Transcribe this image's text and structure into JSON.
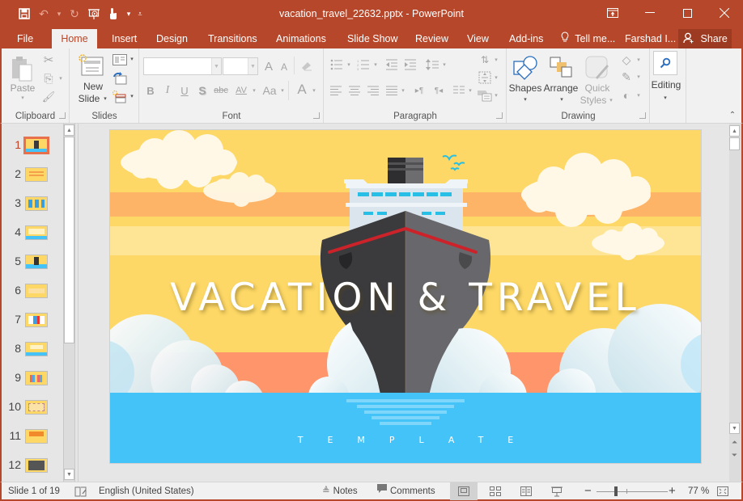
{
  "window": {
    "title": "vacation_travel_22632.pptx - PowerPoint",
    "controls": {
      "ribbon_display": "▣",
      "minimize": "—",
      "maximize": "☐",
      "close": "✕"
    }
  },
  "quick_access": {
    "save_icon": "💾",
    "undo_icon": "↶",
    "undo_dropdown": "▾",
    "redo_icon": "↻",
    "present_icon": "⎚",
    "touch_mode_icon": "☝",
    "touch_dropdown": "▾",
    "customize_icon": "⩡"
  },
  "tabs": [
    {
      "label": "File",
      "active": false
    },
    {
      "label": "Home",
      "active": true
    },
    {
      "label": "Insert",
      "active": false
    },
    {
      "label": "Design",
      "active": false
    },
    {
      "label": "Transitions",
      "active": false
    },
    {
      "label": "Animations",
      "active": false
    },
    {
      "label": "Slide Show",
      "active": false
    },
    {
      "label": "Review",
      "active": false
    },
    {
      "label": "View",
      "active": false
    },
    {
      "label": "Add-ins",
      "active": false
    }
  ],
  "tell_me": {
    "icon": "💡",
    "label": "Tell me..."
  },
  "user": {
    "name": "Farshad I..."
  },
  "share": {
    "icon": "👤",
    "label": "Share"
  },
  "ribbon": {
    "clipboard": {
      "label": "Clipboard",
      "paste": "Paste",
      "paste_dropdown": "▾",
      "cut_icon": "✂",
      "copy_icon": "⎘",
      "copy_dropdown": "▾",
      "format_painter_icon": "🖌"
    },
    "slides": {
      "label": "Slides",
      "new_slide_line1": "New",
      "new_slide_line2": "Slide",
      "new_slide_dropdown": "▾",
      "layout_icon": "▤",
      "reset_icon": "⟲",
      "section_icon": "▭"
    },
    "font": {
      "label": "Font",
      "font_name_value": "",
      "font_size_value": "",
      "grow_font": "A",
      "shrink_font": "A",
      "clear_formatting_icon": "⌫",
      "bold": "B",
      "italic": "I",
      "underline": "U",
      "shadow": "S",
      "strikethrough": "abc",
      "char_spacing": "AV",
      "change_case": "Aa",
      "font_color": "A"
    },
    "paragraph": {
      "label": "Paragraph",
      "bullets_icon": "☰",
      "numbering_icon": "☷",
      "decrease_indent_icon": "⇤",
      "increase_indent_icon": "⇥",
      "line_spacing_icon": "↕",
      "text_direction_icon": "⇅",
      "align_text_icon": "⇳",
      "smartart_icon": "⊞",
      "align_left_icon": "≡",
      "center_icon": "≡",
      "align_right_icon": "≡",
      "justify_icon": "≡",
      "ltr_icon": "▸¶",
      "rtl_icon": "¶◂",
      "columns_icon": "☷"
    },
    "drawing": {
      "label": "Drawing",
      "shapes": "Shapes",
      "arrange": "Arrange",
      "quick_styles_line1": "Quick",
      "quick_styles_line2": "Styles",
      "shape_fill_icon": "◇",
      "shape_outline_icon": "✎",
      "shape_effects_icon": "◐"
    },
    "editing": {
      "label": "Editing",
      "icon": "⌕",
      "dropdown": "▾"
    },
    "collapse_icon": "⌃"
  },
  "thumbnails": [
    {
      "number": "1",
      "active": true
    },
    {
      "number": "2",
      "active": false
    },
    {
      "number": "3",
      "active": false
    },
    {
      "number": "4",
      "active": false
    },
    {
      "number": "5",
      "active": false
    },
    {
      "number": "6",
      "active": false
    },
    {
      "number": "7",
      "active": false
    },
    {
      "number": "8",
      "active": false
    },
    {
      "number": "9",
      "active": false
    },
    {
      "number": "10",
      "active": false
    },
    {
      "number": "11",
      "active": false
    },
    {
      "number": "12",
      "active": false
    }
  ],
  "slide": {
    "title": "VACATION & TRAVEL",
    "subtitle": "TEMPLATE",
    "colors": {
      "sky": "#fdd866",
      "stripe_orange": "#feb466",
      "stripe_light": "#fee596",
      "sunset_band": "#ff956a",
      "sea": "#43c3f7",
      "hull_dark": "#3b3b3e",
      "hull_light": "#68686c",
      "cabin": "#dbe5ee",
      "window": "#27bfe6",
      "stripe_red": "#cc2229",
      "cloud": "#fff8e6"
    }
  },
  "scrollbars": {
    "up": "▲",
    "down": "▼",
    "prev_slide": "⏶",
    "next_slide": "⏷"
  },
  "status": {
    "slide_indicator": "Slide 1 of 19",
    "spellcheck_icon": "📖",
    "language": "English (United States)",
    "notes_icon": "≜",
    "notes": "Notes",
    "comments_icon": "💬",
    "comments": "Comments",
    "view_normal_icon": "▭",
    "view_sorter_icon": "▦",
    "view_reading_icon": "📖",
    "view_slideshow_icon": "⊼",
    "zoom_out": "−",
    "zoom_in": "+",
    "zoom_level": "77 %",
    "zoom_percent_value": 77,
    "fit_icon": "⊡"
  }
}
